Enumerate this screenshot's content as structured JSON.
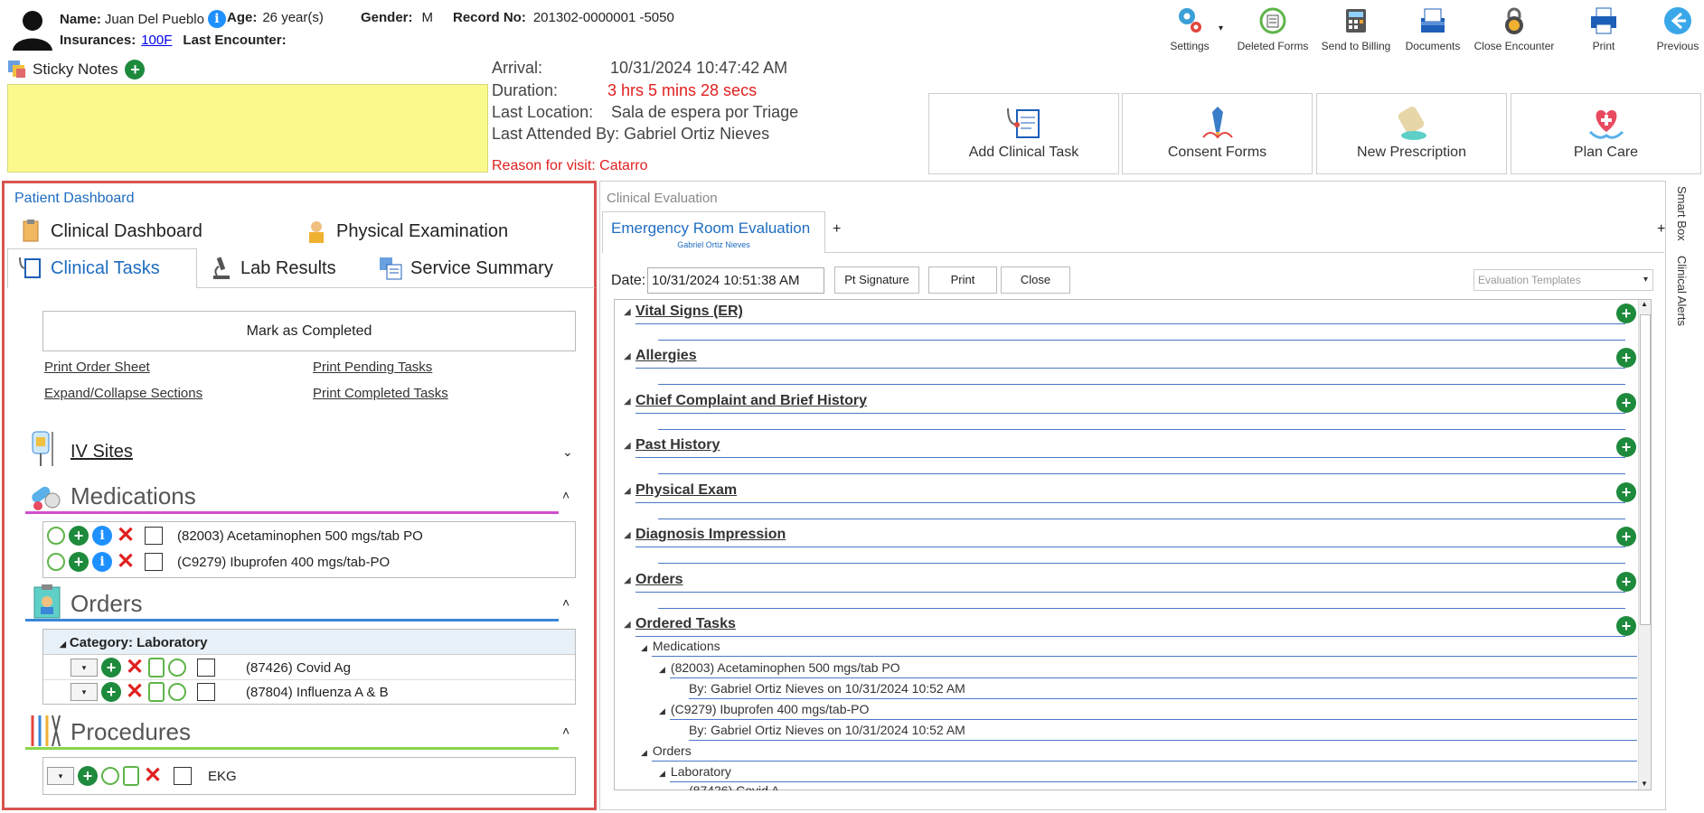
{
  "header": {
    "name_label": "Name:",
    "name_value": "Juan Del Pueblo",
    "age_label": "Age:",
    "age_value": "26 year(s)",
    "gender_label": "Gender:",
    "gender_value": "M",
    "record_label": "Record No:",
    "record_value": "201302-0000001 -5050",
    "insurances_label": "Insurances:",
    "insurances_value": "100F",
    "last_encounter_label": "Last Encounter:"
  },
  "toolbar": [
    {
      "label": "Settings",
      "icon": "gear-icon"
    },
    {
      "label": "Deleted Forms",
      "icon": "restore-icon"
    },
    {
      "label": "Send to Billing",
      "icon": "calculator-icon"
    },
    {
      "label": "Documents",
      "icon": "inbox-icon"
    },
    {
      "label": "Close Encounter",
      "icon": "lock-icon"
    },
    {
      "label": "Print",
      "icon": "printer-icon"
    },
    {
      "label": "Previous",
      "icon": "back-arrow-icon"
    }
  ],
  "sticky": {
    "label": "Sticky Notes"
  },
  "visit": {
    "arrival_label": "Arrival:",
    "arrival_value": "10/31/2024 10:47:42 AM",
    "duration_label": "Duration:",
    "duration_value": "3 hrs 5 mins 28 secs",
    "location_label": "Last Location:",
    "location_value": "Sala de espera por Triage",
    "attended": "Last Attended By: Gabriel Ortiz Nieves",
    "reason": "Reason for visit: Catarro"
  },
  "big_buttons": [
    {
      "label": "Add Clinical Task"
    },
    {
      "label": "Consent Forms"
    },
    {
      "label": "New Prescription"
    },
    {
      "label": "Plan Care"
    }
  ],
  "dashboard": {
    "title": "Patient Dashboard",
    "tabs": [
      "Clinical Dashboard",
      "Physical Examination",
      "Clinical Tasks",
      "Lab Results",
      "Service Summary"
    ],
    "mark_completed": "Mark as Completed",
    "links": [
      "Print Order Sheet",
      "Print Pending Tasks",
      "Expand/Collapse Sections",
      "Print Completed Tasks"
    ],
    "iv_sites": "IV Sites",
    "medications": {
      "title": "Medications",
      "items": [
        "(82003) Acetaminophen 500 mgs/tab PO",
        "(C9279) Ibuprofen 400 mgs/tab-PO"
      ]
    },
    "orders": {
      "title": "Orders",
      "category": "Category: Laboratory",
      "items": [
        "(87426) Covid Ag",
        "(87804) Influenza A & B"
      ]
    },
    "procedures": {
      "title": "Procedures",
      "items": [
        "EKG"
      ]
    },
    "colors": {
      "medications": "#cf4fd0",
      "orders": "#3a86d8",
      "procedures": "#8ad64a",
      "highlight": "#d9534f"
    }
  },
  "evaluation": {
    "panel_title": "Clinical Evaluation",
    "tab_title": "Emergency Room Evaluation",
    "tab_sub": "Gabriel Ortiz Nieves",
    "date_label": "Date:",
    "date_value": "10/31/2024 10:51:38 AM",
    "btn_signature": "Pt Signature",
    "btn_print": "Print",
    "btn_close": "Close",
    "templates_placeholder": "Evaluation Templates",
    "sections": [
      "Vital Signs (ER)",
      "Allergies",
      "Chief Complaint and Brief History",
      "Past History",
      "Physical Exam",
      "Diagnosis Impression",
      "Orders",
      "Ordered Tasks"
    ],
    "tree": {
      "medications": "Medications",
      "med1": "(82003) Acetaminophen 500 mgs/tab PO",
      "med1_by": "By: Gabriel Ortiz Nieves on 10/31/2024 10:52 AM",
      "med2": "(C9279) Ibuprofen 400 mgs/tab-PO",
      "med2_by": "By: Gabriel Ortiz Nieves on 10/31/2024 10:52 AM",
      "orders": "Orders",
      "laboratory": "Laboratory",
      "partial": "(87426) Covid A..."
    }
  },
  "side": {
    "smart_box": "Smart Box",
    "clinical_alerts": "Clinical Alerts"
  }
}
